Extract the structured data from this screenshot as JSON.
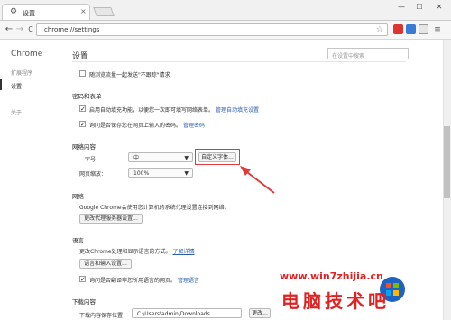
{
  "tab": {
    "title": "设置",
    "close": "×"
  },
  "window": {
    "minimize": "—",
    "maximize": "☐",
    "close": "✕"
  },
  "toolbar": {
    "back": "←",
    "forward": "→",
    "reload": "C",
    "url": "chrome://settings"
  },
  "sidebar": {
    "brand": "Chrome",
    "items": [
      {
        "label": "扩展程序"
      },
      {
        "label": "设置"
      },
      {
        "label": "关于"
      }
    ]
  },
  "header": {
    "title": "设置",
    "search_placeholder": "在设置中搜索"
  },
  "privacy": {
    "dnt_label": "随浏览流量一起发送\"不跟踪\"请求"
  },
  "passwords": {
    "heading": "密码和表单",
    "autofill_label": "启用自动填充功能，以便您一次即可填写网络表单。",
    "autofill_link": "管理自动填充设置",
    "save_pw_label": "询问是否保存您在网页上输入的密码。",
    "save_pw_link": "管理密码"
  },
  "web_content": {
    "heading": "网络内容",
    "font_size_label": "字号：",
    "font_size_value": "中",
    "customize_fonts_button": "自定义字体...",
    "zoom_label": "网页缩放：",
    "zoom_value": "100%"
  },
  "network": {
    "heading": "网络",
    "description": "Google Chrome会使用您计算机的系统代理设置连接到网络。",
    "proxy_button": "更改代理服务器设置..."
  },
  "languages": {
    "heading": "语言",
    "description": "更改Chrome处理和显示语言的方式。",
    "learn_more": "了解详情",
    "lang_input_button": "语言和输入设置...",
    "translate_label": "询问是否翻译非您所用语言的网页。",
    "translate_link": "管理语言"
  },
  "downloads": {
    "heading": "下载内容",
    "location_label": "下载内容保存位置：",
    "location_value": "C:\\Users\\admin\\Downloads",
    "change_button": "更改..."
  },
  "watermark": {
    "url": "www.win7zhijia.cn",
    "text": "电脑技术吧"
  },
  "colors": {
    "accent_link": "#2a5db0",
    "highlight": "#e03a3a"
  }
}
